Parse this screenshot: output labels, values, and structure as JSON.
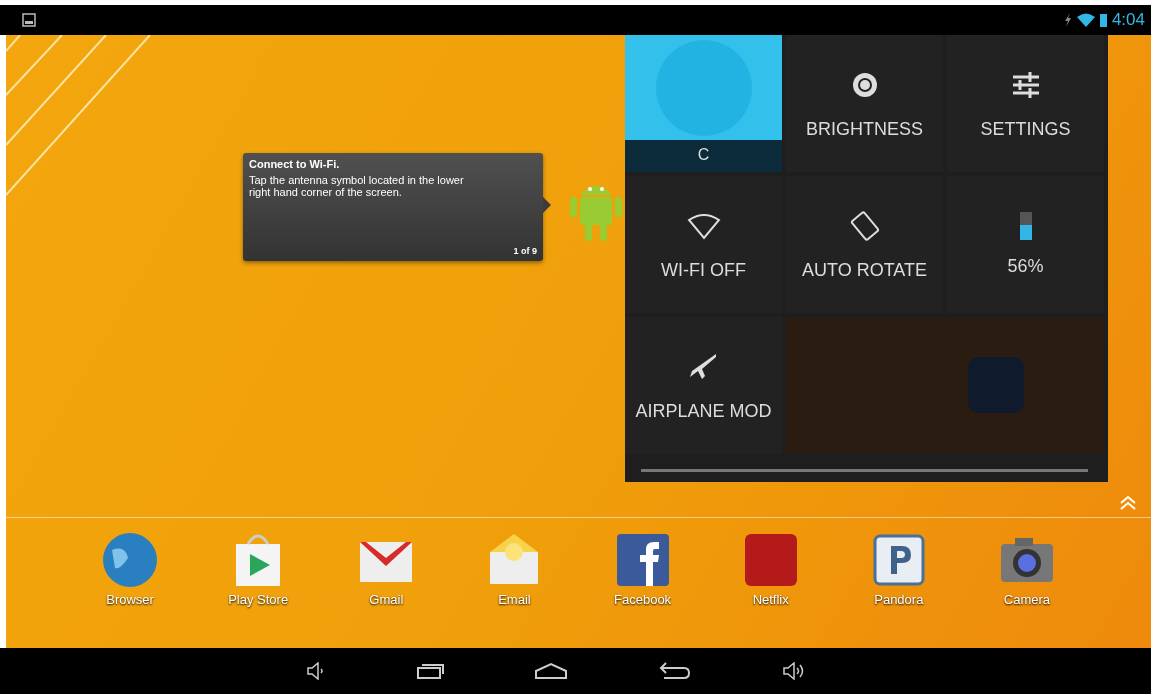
{
  "status_bar": {
    "time": "4:04"
  },
  "tooltip": {
    "title": "Connect to Wi-Fi.",
    "body": "Tap the antenna symbol located in the lower right hand corner of the screen.",
    "counter": "1 of 9"
  },
  "quick_settings": {
    "tiles": [
      {
        "kind": "user",
        "label": "C"
      },
      {
        "kind": "brightness",
        "label": "BRIGHTNESS"
      },
      {
        "kind": "settings",
        "label": "SETTINGS"
      },
      {
        "kind": "wifi",
        "label": "WI-FI OFF"
      },
      {
        "kind": "rotate",
        "label": "AUTO ROTATE"
      },
      {
        "kind": "battery",
        "label": "56%"
      },
      {
        "kind": "airplane",
        "label": "AIRPLANE MOD"
      }
    ]
  },
  "dock": [
    {
      "kind": "globe",
      "label": "Browser"
    },
    {
      "kind": "store",
      "label": "Play Store"
    },
    {
      "kind": "mail",
      "label": "Gmail"
    },
    {
      "kind": "envelope",
      "label": "Email"
    },
    {
      "kind": "f",
      "label": "Facebook"
    },
    {
      "kind": "tv",
      "label": "Netflix"
    },
    {
      "kind": "p",
      "label": "Pandora"
    },
    {
      "kind": "camera",
      "label": "Camera"
    }
  ]
}
